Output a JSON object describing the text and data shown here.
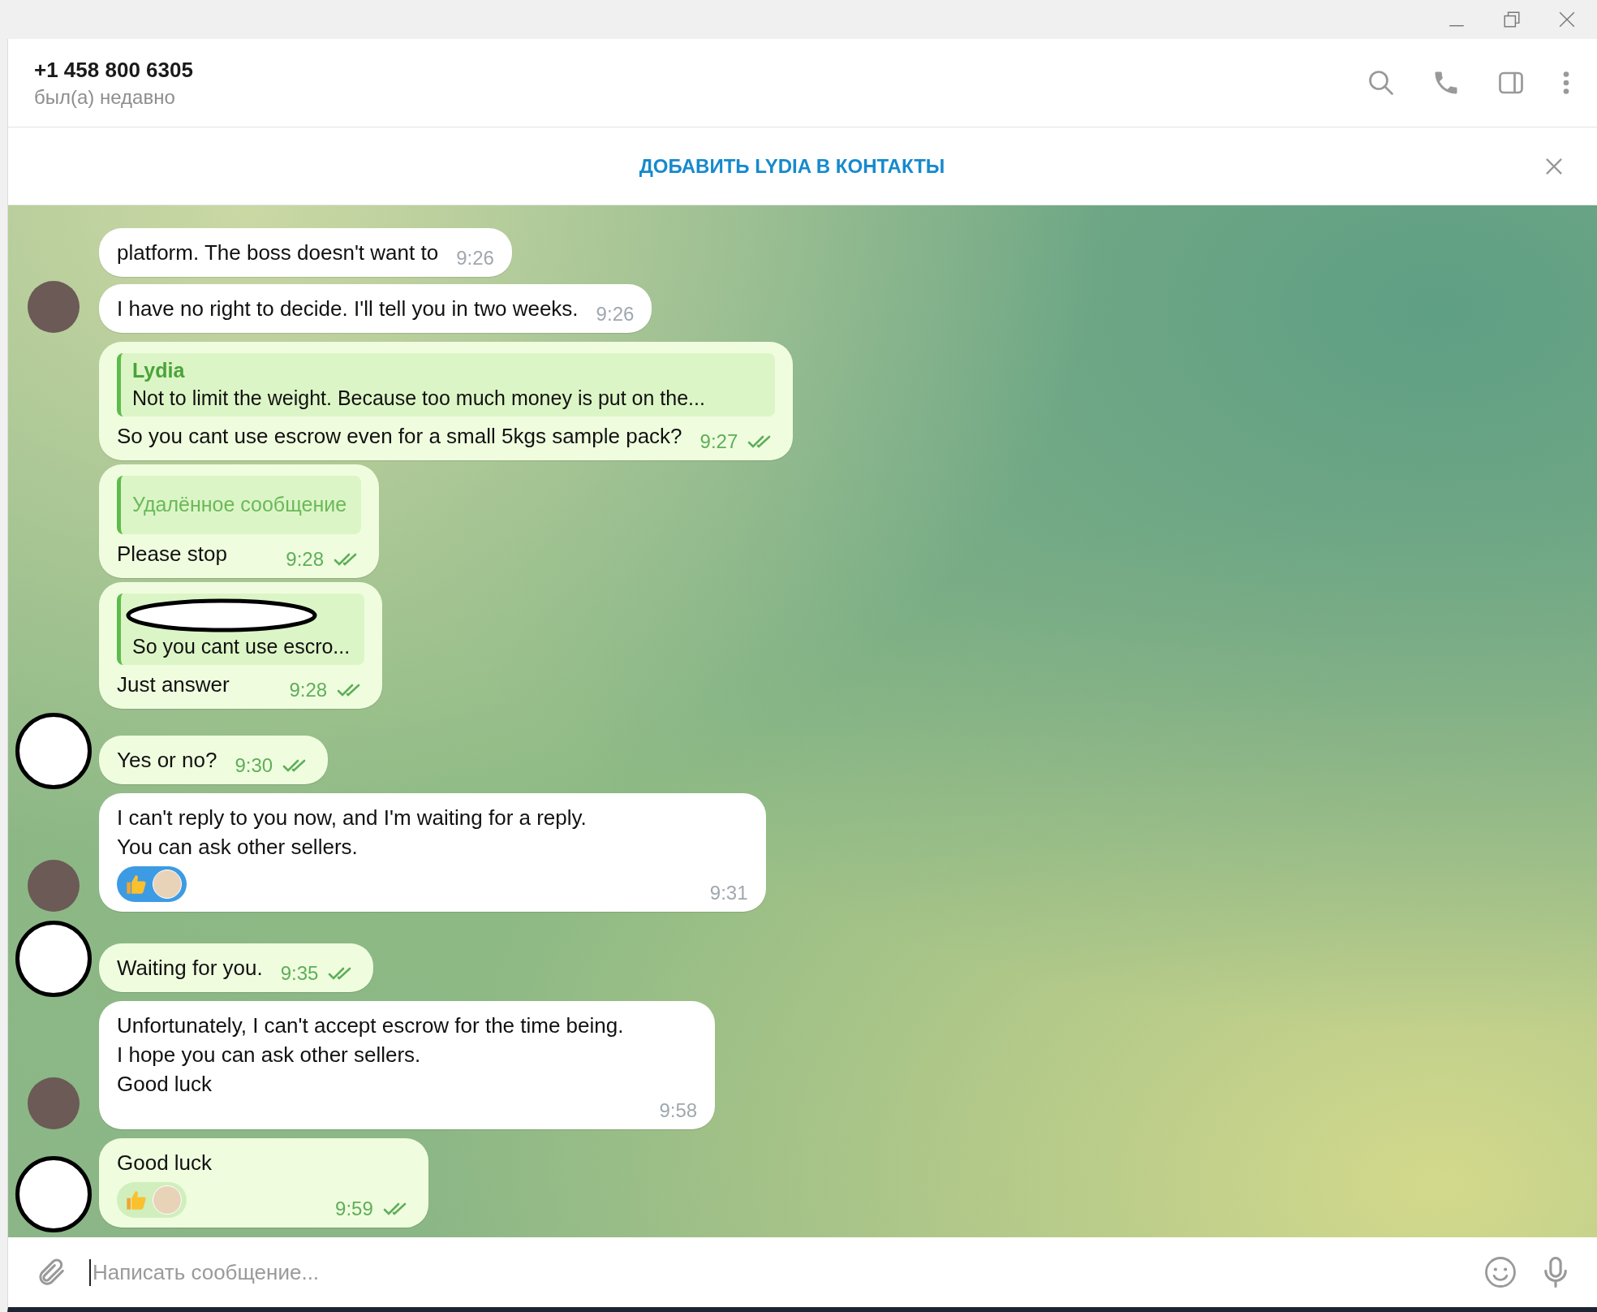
{
  "header": {
    "name": "+1 458 800 6305",
    "status": "был(а) недавно"
  },
  "banner": {
    "label": "ДОБАВИТЬ LYDIA В КОНТАКТЫ"
  },
  "messages": [
    {
      "kind": "incoming",
      "text": "platform. The boss doesn't want to",
      "time": "9:26",
      "avatar": false
    },
    {
      "kind": "incoming",
      "text": "I have no right to decide. I'll tell you in two weeks.",
      "time": "9:26",
      "avatar": true
    },
    {
      "kind": "outgoing",
      "reply": {
        "kind": "named",
        "author": "Lydia",
        "text": "Not to limit the weight. Because too much money is put on the..."
      },
      "text": "So you cant use escrow even for a small 5kgs sample pack?",
      "time": "9:27",
      "read": true,
      "avatar": false
    },
    {
      "kind": "outgoing",
      "reply": {
        "kind": "deleted",
        "text": "Удалённое сообщение"
      },
      "text": "Please stop",
      "time": "9:28",
      "read": true,
      "avatar": false
    },
    {
      "kind": "outgoing",
      "reply": {
        "kind": "redacted",
        "text": "So you cant use escro..."
      },
      "text": "Just answer",
      "time": "9:28",
      "read": true,
      "avatar": false
    },
    {
      "kind": "outgoing",
      "text": "Yes or no?",
      "time": "9:30",
      "read": true,
      "avatar": true
    },
    {
      "kind": "incoming",
      "text": "I can't reply to you now, and I'm waiting for a reply.\nYou can ask other sellers.",
      "reaction": {
        "selected": true
      },
      "time": "9:31",
      "avatar": true
    },
    {
      "kind": "outgoing",
      "text": "Waiting for you.",
      "time": "9:35",
      "read": true,
      "avatar": true
    },
    {
      "kind": "incoming",
      "text": "Unfortunately, I can't accept escrow for the time being.\nI hope you can ask other sellers.\nGood luck",
      "time": "9:58",
      "avatar": true
    },
    {
      "kind": "outgoing",
      "text": "Good luck",
      "reaction": {
        "selected": false
      },
      "time": "9:59",
      "read": true,
      "avatar": true
    }
  ],
  "composer": {
    "placeholder": "Написать сообщение..."
  }
}
